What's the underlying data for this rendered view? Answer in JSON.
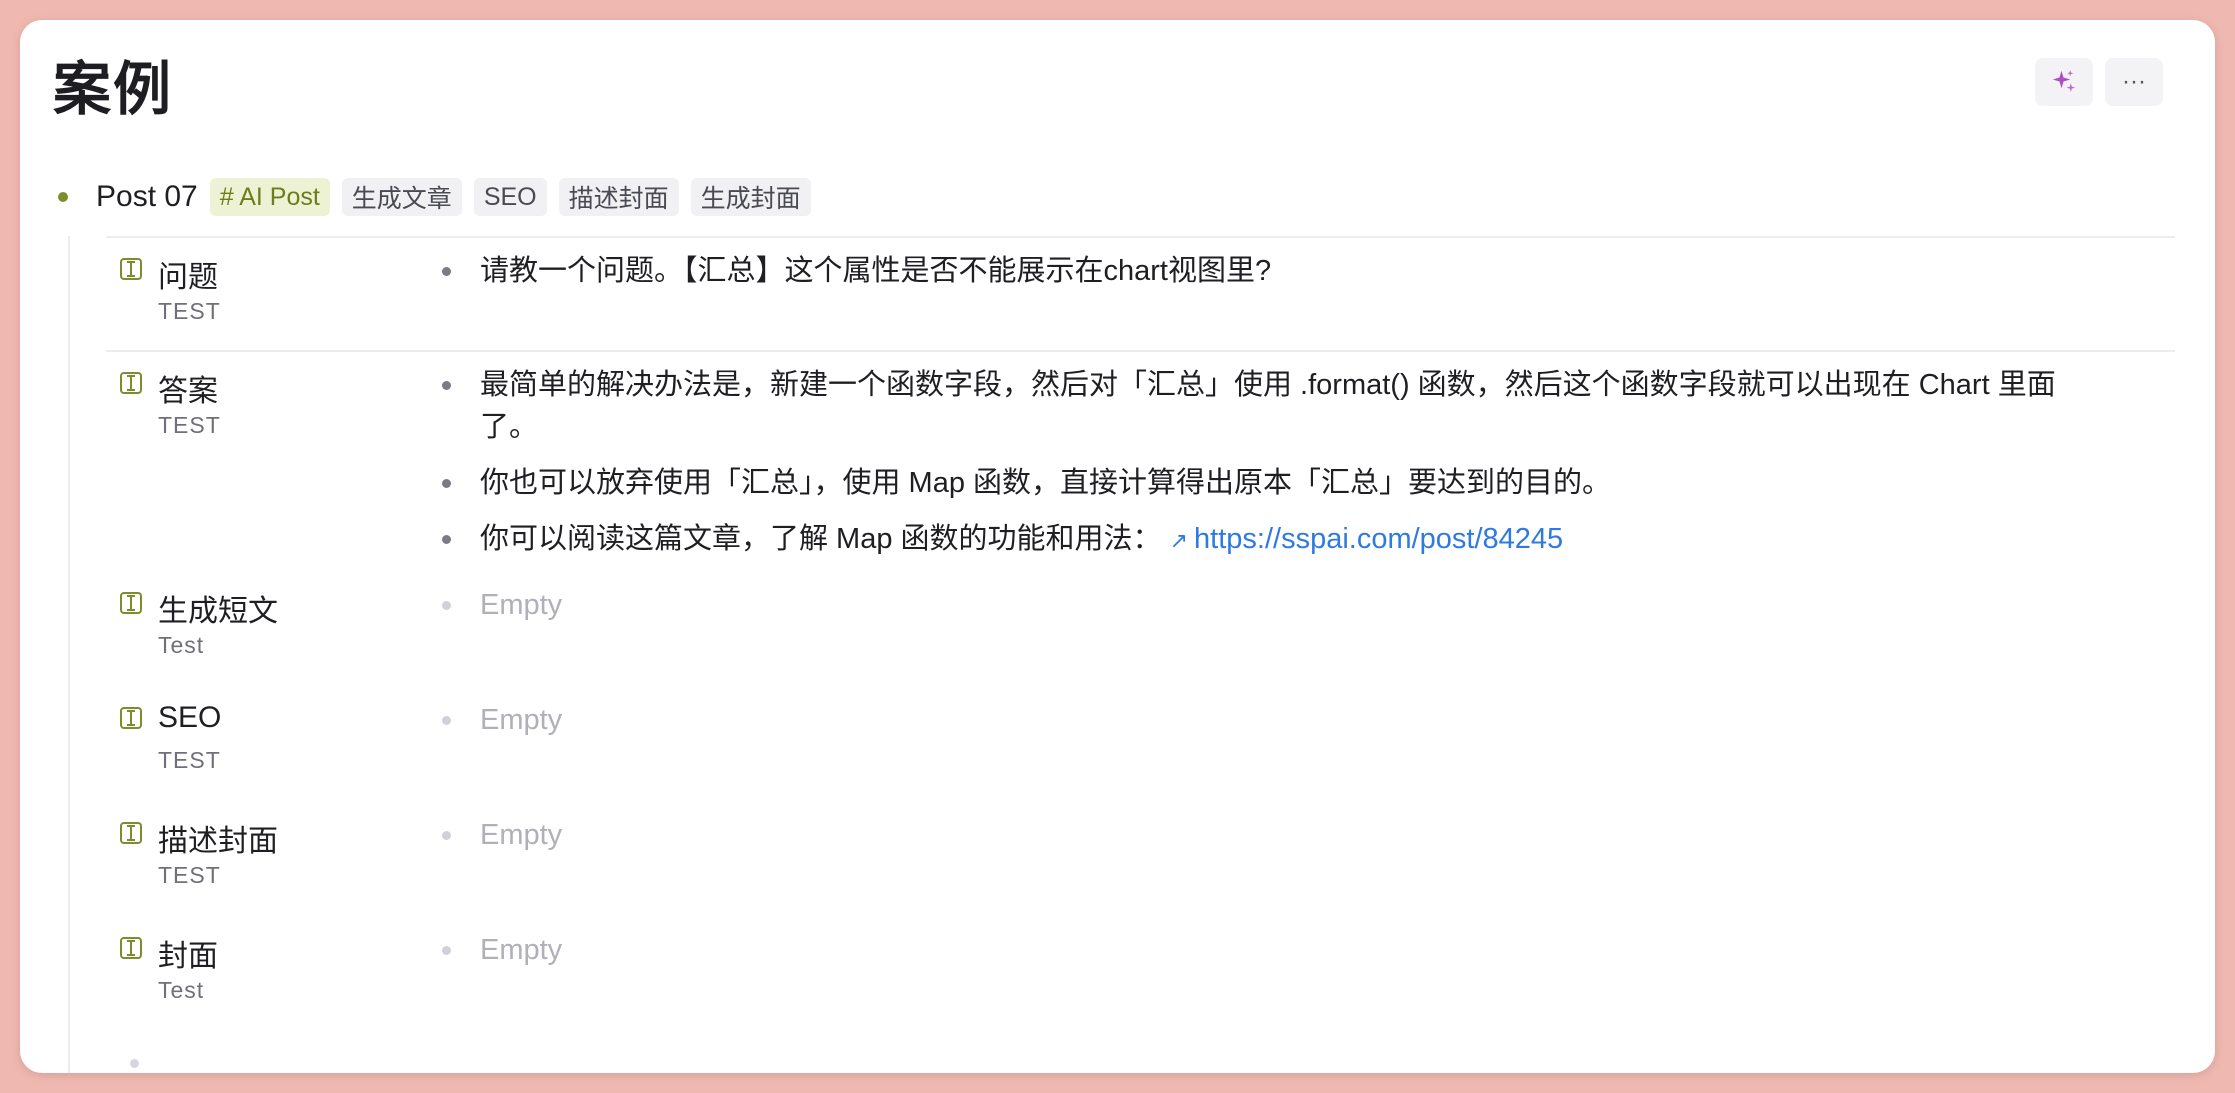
{
  "page": {
    "title": "案例"
  },
  "toolbar": {
    "ai_icon": "sparkles-icon",
    "more_label": "···"
  },
  "node": {
    "title": "Post 07",
    "tags": [
      "# AI Post",
      "生成文章",
      "SEO",
      "描述封面",
      "生成封面"
    ]
  },
  "fields": [
    {
      "name": "问题",
      "desc": "TEST",
      "values": [
        {
          "text": "请教一个问题。【汇总】这个属性是否不能展示在chart视图里?"
        }
      ]
    },
    {
      "name": "答案",
      "desc": "TEST",
      "values": [
        {
          "text": "最简单的解决办法是，新建一个函数字段，然后对「汇总」使用 .format() 函数，然后这个函数字段就可以出现在 Chart 里面了。"
        },
        {
          "text": "你也可以放弃使用「汇总」，使用 Map 函数，直接计算得出原本「汇总」要达到的目的。"
        },
        {
          "text": "你可以阅读这篇文章，了解 Map 函数的功能和用法：",
          "link": "https://sspai.com/post/84245"
        }
      ]
    },
    {
      "name": "生成短文",
      "desc": "Test",
      "values": [
        {
          "text": "Empty"
        }
      ]
    },
    {
      "name": "SEO",
      "desc": "TEST",
      "values": [
        {
          "text": "Empty"
        }
      ]
    },
    {
      "name": "描述封面",
      "desc": "TEST",
      "values": [
        {
          "text": "Empty"
        }
      ]
    },
    {
      "name": "封面",
      "desc": "Test",
      "values": [
        {
          "text": "Empty"
        }
      ]
    }
  ]
}
